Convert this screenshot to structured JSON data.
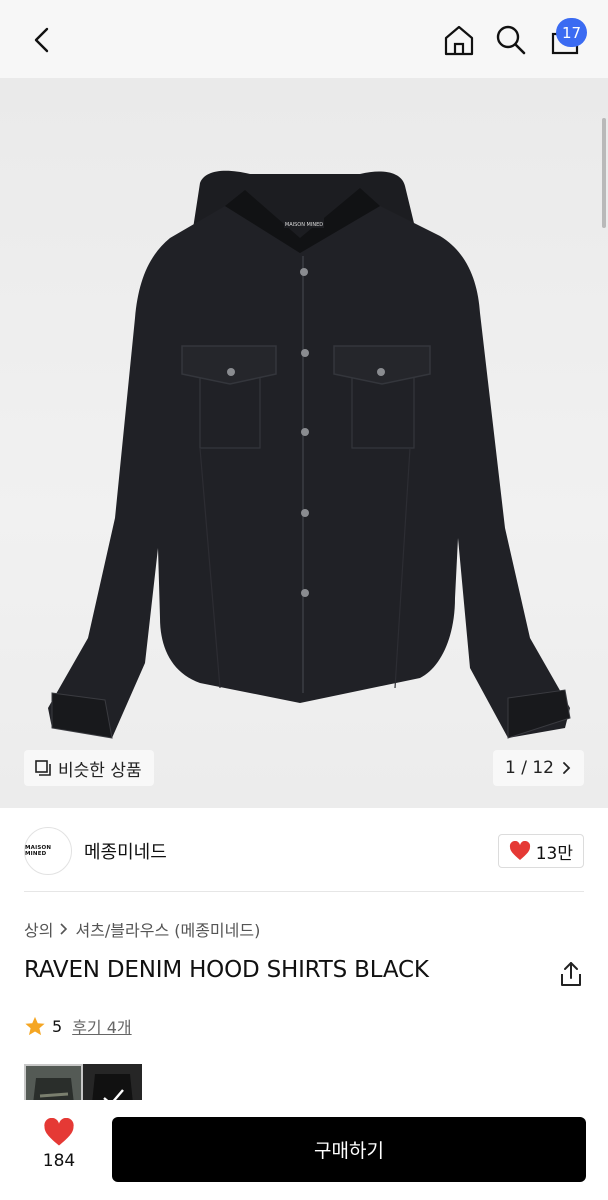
{
  "header": {
    "cart_count": "17",
    "icons": {
      "back": "chevron-left-icon",
      "home": "home-icon",
      "search": "search-icon",
      "cart": "shopping-bag-icon"
    }
  },
  "hero": {
    "similar_label": "비슷한 상품",
    "page_counter": "1 / 12",
    "jacket_label": "MAISON MINED"
  },
  "brand": {
    "name": "메종미네드",
    "logo_text": "MAISON MINED",
    "likes": "13만"
  },
  "breadcrumb": {
    "category": "상의",
    "subcategory": "셔츠/블라우스 (메종미네드)"
  },
  "product": {
    "title": "RAVEN DENIM HOOD SHIRTS BLACK",
    "rating": "5",
    "reviews": "후기 4개"
  },
  "bottom": {
    "wish_count": "184",
    "buy_label": "구매하기"
  },
  "colors": {
    "accent": "#3b6bf2",
    "heart": "#e53935",
    "star": "#f5a623",
    "buy_bg": "#000000"
  }
}
